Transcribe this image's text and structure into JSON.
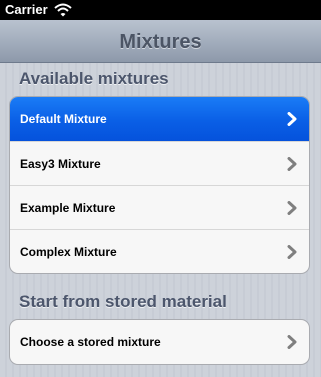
{
  "status_bar": {
    "carrier": "Carrier",
    "wifi_icon": "wifi-icon"
  },
  "nav": {
    "title": "Mixtures"
  },
  "sections": [
    {
      "header": "Available mixtures",
      "rows": [
        {
          "label": "Default Mixture",
          "selected": true
        },
        {
          "label": "Easy3 Mixture",
          "selected": false
        },
        {
          "label": "Example Mixture",
          "selected": false
        },
        {
          "label": "Complex Mixture",
          "selected": false
        }
      ]
    },
    {
      "header": "Start from stored material",
      "rows": [
        {
          "label": "Choose a stored mixture",
          "selected": false
        }
      ]
    }
  ],
  "colors": {
    "selection": "#0a5fe6",
    "nav_title": "#4c5565",
    "section_header": "#4c566c",
    "chevron": "#7f7f7f"
  },
  "icons": {
    "disclosure": "chevron-right-icon"
  }
}
